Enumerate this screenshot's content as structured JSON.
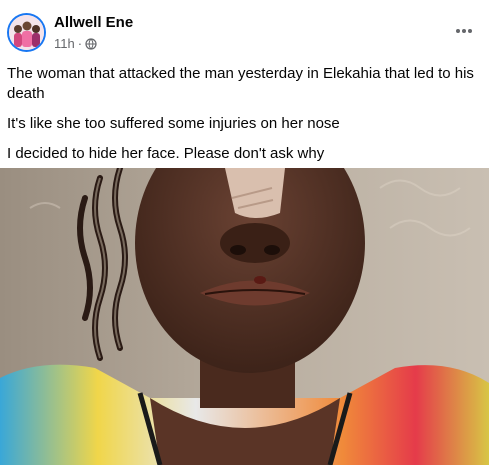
{
  "post": {
    "author": "Allwell Ene",
    "time": "11h",
    "separator": "·",
    "privacy_icon": "globe-icon",
    "more_icon": "more-options-icon",
    "paragraphs": [
      "The woman that attacked the man yesterday in Elekahia that led to his death",
      "It's like she too suffered some injuries on her nose",
      "I decided to hide her face. Please don't ask why"
    ]
  },
  "colors": {
    "author_text": "#050505",
    "meta_text": "#65676b",
    "avatar_ring": "#1877f2"
  }
}
